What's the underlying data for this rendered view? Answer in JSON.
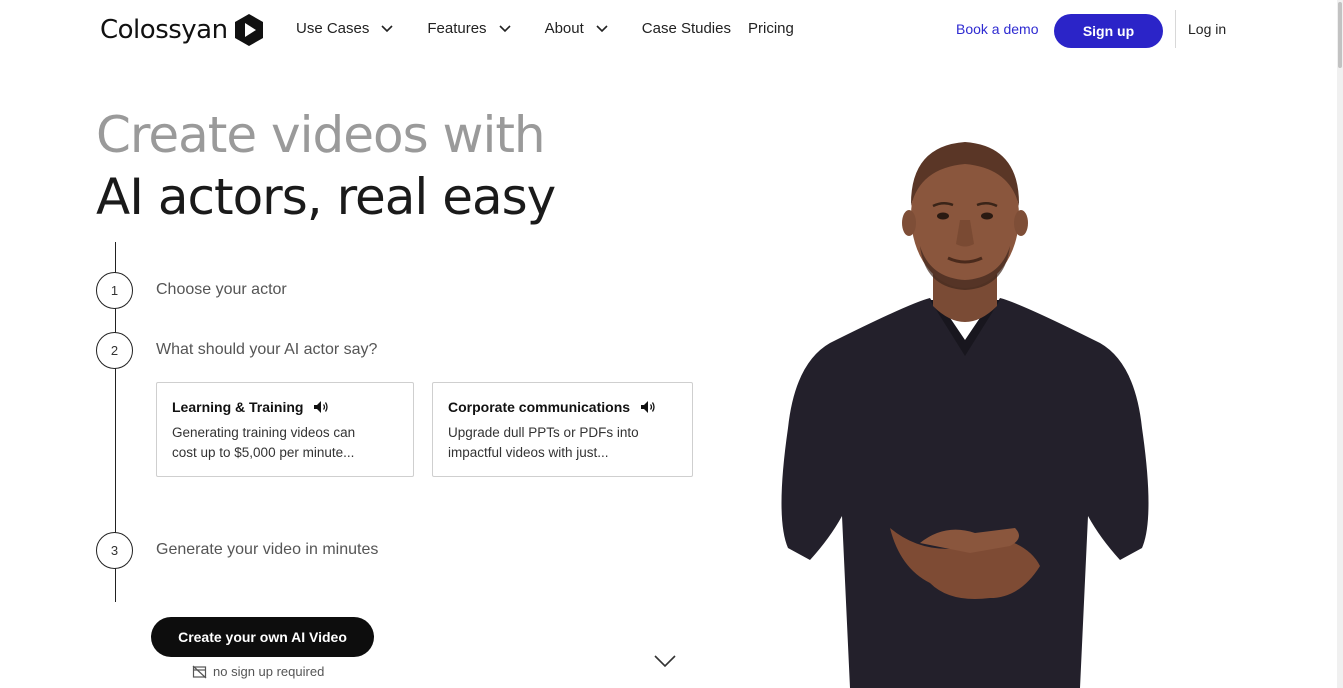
{
  "header": {
    "logo_text": "Colossyan",
    "nav": [
      {
        "label": "Use Cases",
        "has_dropdown": true
      },
      {
        "label": "Features",
        "has_dropdown": true
      },
      {
        "label": "About",
        "has_dropdown": true
      },
      {
        "label": "Case Studies",
        "has_dropdown": false
      },
      {
        "label": "Pricing",
        "has_dropdown": false
      }
    ],
    "book_demo": "Book a demo",
    "sign_up": "Sign up",
    "log_in": "Log in"
  },
  "hero": {
    "line1": "Create videos with",
    "line2": "AI actors, real easy"
  },
  "steps": [
    {
      "number": "1",
      "label": "Choose your actor"
    },
    {
      "number": "2",
      "label": "What should your AI actor say?"
    },
    {
      "number": "3",
      "label": "Generate your video in minutes"
    }
  ],
  "cards": [
    {
      "title": "Learning & Training",
      "desc_line1": "Generating training videos can",
      "desc_line2": "cost up to $5,000 per minute..."
    },
    {
      "title": "Corporate communications",
      "desc_line1": "Upgrade dull PPTs or PDFs into",
      "desc_line2": "impactful videos with just..."
    }
  ],
  "cta": {
    "label": "Create your own AI Video",
    "note": "no sign up required"
  },
  "colors": {
    "accent": "#2b24c8",
    "accent_text": "#2e2ad1",
    "cta_bg": "#0d0d0d",
    "hero_muted": "#9a9a9a"
  },
  "icons": [
    "chevron-down-icon",
    "speaker-icon",
    "no-card-icon",
    "scroll-down-chevron-icon",
    "logo-play-icon"
  ]
}
